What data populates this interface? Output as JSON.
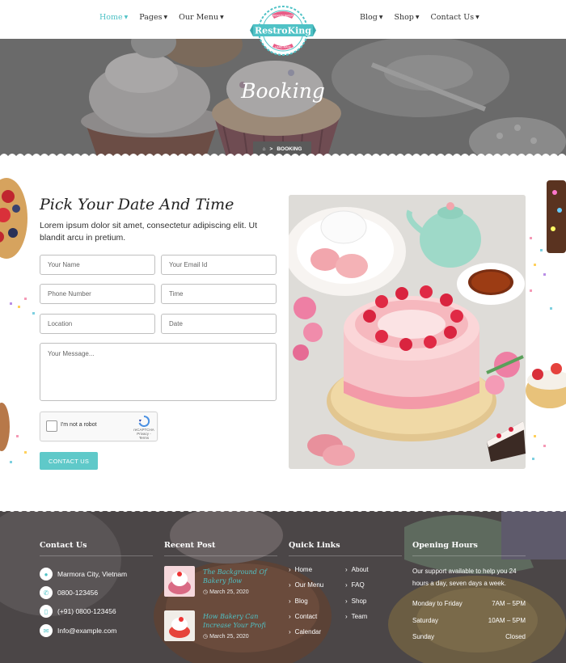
{
  "nav": {
    "left": [
      {
        "label": "Home",
        "active": true
      },
      {
        "label": "Pages",
        "active": false
      },
      {
        "label": "Our Menu",
        "active": false
      }
    ],
    "right": [
      {
        "label": "Blog"
      },
      {
        "label": "Shop"
      },
      {
        "label": "Contact Us"
      }
    ]
  },
  "logo": {
    "text": "RestroKing",
    "top_ribbon": "PREMIUM BAKERY",
    "bottom_ribbon": "HAND MADE"
  },
  "hero": {
    "title": "Booking",
    "breadcrumb": "BOOKING"
  },
  "booking": {
    "title": "Pick Your Date And Time",
    "description": "Lorem ipsum dolor sit amet, consectetur adipiscing elit. Ut blandit arcu in pretium.",
    "fields": [
      {
        "name": "name",
        "placeholder": "Your Name"
      },
      {
        "name": "email",
        "placeholder": "Your Email Id"
      },
      {
        "name": "phone",
        "placeholder": "Phone Number"
      },
      {
        "name": "time",
        "placeholder": "Time"
      },
      {
        "name": "location",
        "placeholder": "Location"
      },
      {
        "name": "date",
        "placeholder": "Date"
      }
    ],
    "message_placeholder": "Your Message...",
    "captcha": {
      "label": "I'm not a robot",
      "brand": "reCAPTCHA",
      "links": "Privacy - Terms"
    },
    "submit_label": "CONTACT US"
  },
  "footer": {
    "contact": {
      "heading": "Contact Us",
      "items": [
        {
          "icon": "location-pin-icon",
          "text": "Marmora City, Vietnam"
        },
        {
          "icon": "phone-icon",
          "text": "0800-123456"
        },
        {
          "icon": "mobile-icon",
          "text": "(+91) 0800-123456"
        },
        {
          "icon": "email-icon",
          "text": "Info@example.com"
        }
      ]
    },
    "recent": {
      "heading": "Recent Post",
      "posts": [
        {
          "title": "The Background Of Bakery flow",
          "date": "March 25, 2020"
        },
        {
          "title": "How Bakery Can Increase Your Profi",
          "date": "March 25, 2020"
        }
      ]
    },
    "quick": {
      "heading": "Quick Links",
      "col1": [
        "Home",
        "Our Menu",
        "Blog",
        "Contact",
        "Calendar"
      ],
      "col2": [
        "About",
        "FAQ",
        "Shop",
        "Team"
      ]
    },
    "hours": {
      "heading": "Opening Hours",
      "text": "Our support available to help you 24 hours a day, seven days a week.",
      "rows": [
        {
          "day": "Monday to Friday",
          "time": "7AM – 5PM"
        },
        {
          "day": "Saturday",
          "time": "10AM – 5PM"
        },
        {
          "day": "Sunday",
          "time": "Closed"
        }
      ]
    }
  },
  "colors": {
    "accent": "#4fc2c6",
    "button": "#5fc9c9",
    "ribbon": "#e85c87"
  }
}
